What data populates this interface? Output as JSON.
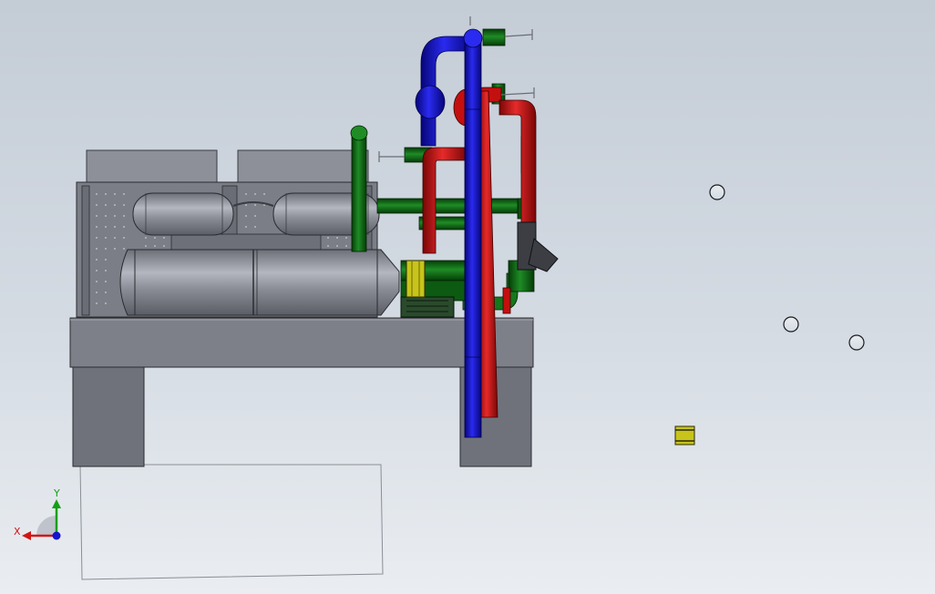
{
  "viewport": {
    "background_top": "#c4ccd6",
    "background_bottom": "#eaedf1"
  },
  "colors": {
    "steel": "#7c7f88",
    "steel_light": "#9a9da6",
    "steel_dark": "#55585f",
    "pipe_blue": "#1010b8",
    "pipe_red": "#c40f0f",
    "pipe_green": "#0f6a14",
    "yellow_fitting": "#c8c41a"
  },
  "triad": {
    "x_label": "X",
    "y_label": "Y",
    "x_color": "#d21414",
    "y_color": "#14a014",
    "z_color": "#1414d2"
  },
  "model": {
    "parts": [
      "base-frame",
      "left-support-leg",
      "right-support-leg",
      "condenser-housing",
      "upper-vessel-left",
      "upper-vessel-right",
      "main-receiver-tank",
      "fan-guard-left",
      "fan-guard-right",
      "blue-supply-pipe",
      "red-return-pipe",
      "green-pipe-manifold",
      "strainer-fitting",
      "pump-motor"
    ],
    "floating_parts": [
      "loose-ring-1",
      "loose-ring-2",
      "loose-ring-3",
      "loose-coupling"
    ]
  }
}
